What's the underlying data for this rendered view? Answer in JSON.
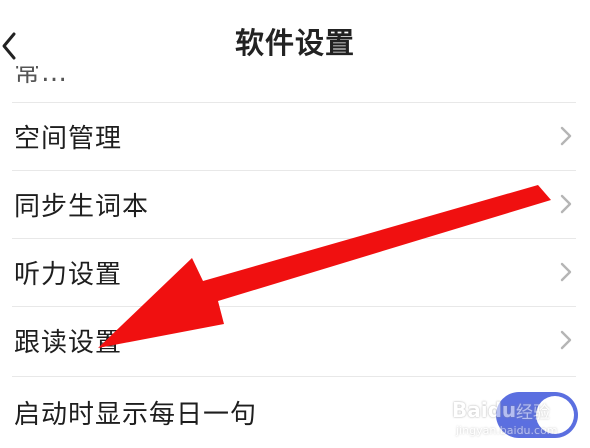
{
  "header": {
    "title": "软件设置",
    "back_icon": "chevron-left-icon"
  },
  "partial_item": {
    "label": "常…"
  },
  "settings": [
    {
      "label": "空间管理",
      "control": "chevron-right-icon"
    },
    {
      "label": "同步生词本",
      "control": "chevron-right-icon"
    },
    {
      "label": "听力设置",
      "control": "chevron-right-icon"
    },
    {
      "label": "跟读设置",
      "control": "chevron-right-icon"
    },
    {
      "label": "启动时显示每日一句",
      "control": "toggle",
      "toggle_on": true
    }
  ],
  "annotation": {
    "arrow_color": "#f01010",
    "arrow_target": "跟读设置"
  },
  "watermark": {
    "brand": "Baidu",
    "sub": "经验",
    "url": "jingyan.baidu.com"
  },
  "colors": {
    "toggle_on": "#5b6fe0",
    "divider": "#e8e8e8",
    "chevron": "#b5b5b5"
  }
}
